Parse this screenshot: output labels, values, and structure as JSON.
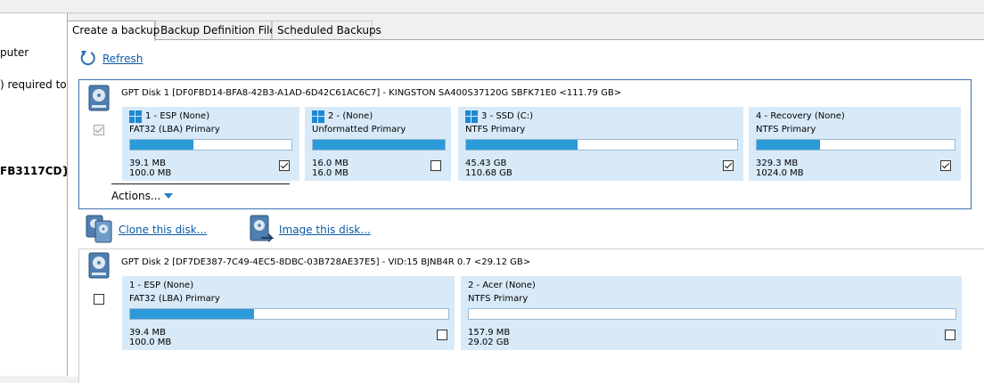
{
  "left_pane": {
    "lines": [
      "puter",
      ") required to",
      "FB3117CD}"
    ]
  },
  "tabs": [
    {
      "label": "Create a backup",
      "active": true
    },
    {
      "label": "Backup Definition Files",
      "active": false
    },
    {
      "label": "Scheduled Backups",
      "active": false
    }
  ],
  "refresh": {
    "label": "Refresh"
  },
  "colors": {
    "accent": "#2b9ad8",
    "partition_bg": "#d8eaf8",
    "link": "#0b5aa8",
    "selected_border": "#3b74b6"
  },
  "disks": [
    {
      "title": "GPT Disk 1 [DF0FBD14-BFA8-42B3-A1AD-6D42C61AC6C7] - KINGSTON SA400S37120G SBFK71E0  <111.79 GB>",
      "selected": true,
      "select_disabled": true,
      "partitions": [
        {
          "title": "1 - ESP (None)",
          "type": "FAT32 (LBA) Primary",
          "used": "39.1 MB",
          "total": "100.0 MB",
          "fill": 0.39,
          "checked": true,
          "windows_icon": true
        },
        {
          "title": "2 -  (None)",
          "type": "Unformatted Primary",
          "used": "16.0 MB",
          "total": "16.0 MB",
          "fill": 1.0,
          "checked": false,
          "windows_icon": true
        },
        {
          "title": "3 - SSD (C:)",
          "type": "NTFS Primary",
          "used": "45.43 GB",
          "total": "110.68 GB",
          "fill": 0.41,
          "checked": true,
          "windows_icon": true
        },
        {
          "title": "4 - Recovery (None)",
          "type": "NTFS Primary",
          "used": "329.3 MB",
          "total": "1024.0 MB",
          "fill": 0.32,
          "checked": true,
          "windows_icon": false
        }
      ],
      "actions_label": "Actions..."
    },
    {
      "title": "GPT Disk 2 [DF7DE387-7C49-4EC5-8DBC-03B728AE37E5] - VID:15 BJNB4R 0.7  <29.12 GB>",
      "selected": false,
      "select_disabled": false,
      "partitions": [
        {
          "title": "1 - ESP (None)",
          "type": "FAT32 (LBA) Primary",
          "used": "39.4 MB",
          "total": "100.0 MB",
          "fill": 0.39,
          "checked": false,
          "windows_icon": false
        },
        {
          "title": "2 - Acer (None)",
          "type": "NTFS Primary",
          "used": "157.9 MB",
          "total": "29.02 GB",
          "fill": 0.0,
          "checked": false,
          "windows_icon": false
        }
      ]
    }
  ],
  "operations": {
    "clone_label": "Clone this disk...",
    "image_label": "Image this disk..."
  }
}
